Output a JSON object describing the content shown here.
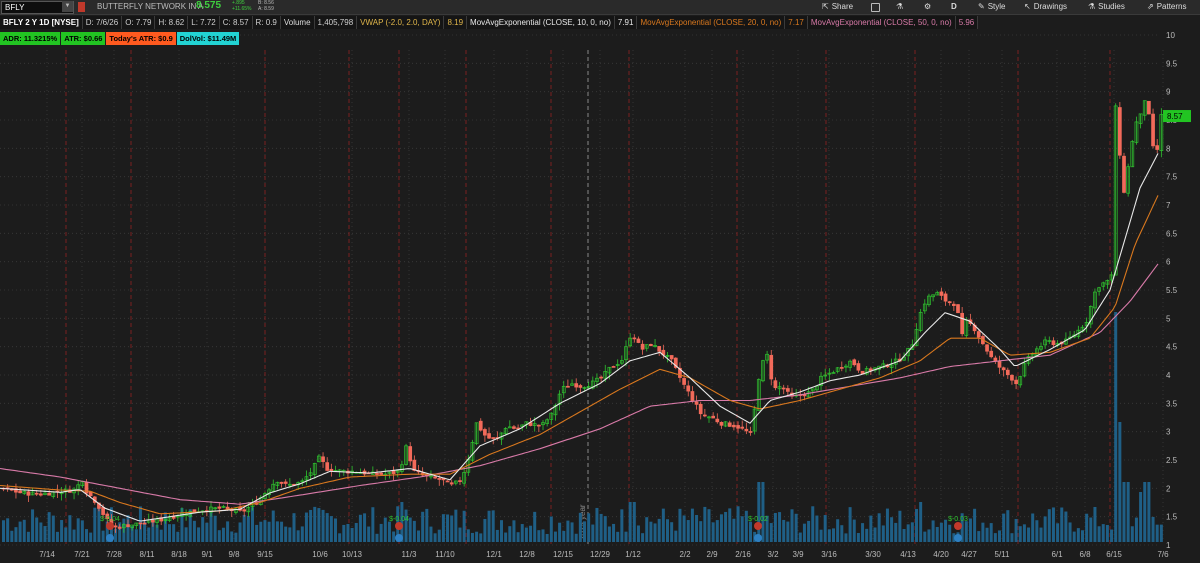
{
  "toolbar": {
    "symbol": "BFLY",
    "company": "BUTTERFLY NETWORK IN A",
    "last": "8.575",
    "change": "+.895",
    "change_pct": "+11.65%",
    "bid": "B: 8.56",
    "ask": "A: 8.59",
    "share": "Share",
    "period": "D",
    "style": "Style",
    "drawings": "Drawings",
    "studies": "Studies",
    "patterns": "Patterns",
    "icons": [
      "share-icon",
      "save-icon",
      "flask-icon",
      "settings-icon",
      "style-icon",
      "drawings-icon",
      "studies-icon",
      "patterns-icon"
    ]
  },
  "infobar": {
    "title": "BFLY 2 Y 1D [NYSE]",
    "date": "D: 7/6/26",
    "open": "O: 7.79",
    "high": "H: 8.62",
    "low": "L: 7.72",
    "close": "C: 8.57",
    "range": "R: 0.9",
    "volume_label": "Volume",
    "volume": "1,405,798",
    "vwap_label": "VWAP (-2.0, 2.0, DAY)",
    "vwap": "8.19",
    "ema10_label": "MovAvgExponential (CLOSE, 10, 0, no)",
    "ema10": "7.91",
    "ema20_label": "MovAvgExponential (CLOSE, 20, 0, no)",
    "ema20": "7.17",
    "ema50_label": "MovAvgExponential (CLOSE, 50, 0, no)",
    "ema50": "5.96"
  },
  "studies": [
    {
      "label": "ADR: 11.3215%",
      "bg": "#22c422"
    },
    {
      "label": "ATR: $0.66",
      "bg": "#22c422"
    },
    {
      "label": "Today's ATR: $0.9",
      "bg": "#ff5a1f"
    },
    {
      "label": "DolVol: $11.49M",
      "bg": "#22d3d3"
    }
  ],
  "colors": {
    "up": "#2fc42f",
    "down": "#f26a5a",
    "ema10": "#e8e8e8",
    "ema20": "#d9781e",
    "ema50": "#d87aa8",
    "volume": "#1f5f86",
    "grid": "#3a3a3a",
    "vline": "#7a2020"
  },
  "chart_data": {
    "type": "candlestick",
    "y_axis": {
      "min": 1,
      "max": 10,
      "ticks": [
        "10",
        "9.5",
        "9",
        "8.5",
        "8",
        "7.5",
        "7",
        "6.5",
        "6",
        "5.5",
        "5",
        "4.5",
        "4",
        "3.5",
        "3",
        "2.5",
        "2",
        "1.5",
        "1"
      ]
    },
    "last_price_tag": "8.57",
    "x_ticks": [
      "7/14",
      "7/21",
      "7/28",
      "8/11",
      "8/18",
      "9/1",
      "9/8",
      "9/15",
      "10/6",
      "10/13",
      "11/3",
      "11/10",
      "12/1",
      "12/8",
      "12/15",
      "12/29",
      "1/12",
      "2/2",
      "2/9",
      "2/16",
      "3/2",
      "3/9",
      "3/16",
      "3/30",
      "4/13",
      "4/20",
      "4/27",
      "5/11",
      "6/1",
      "6/8",
      "6/15",
      "7/6"
    ],
    "year_marker": "2025 year",
    "dividend_labels": [
      "$-0.04",
      "$-0.04",
      "$-0.02",
      "$-0.03"
    ],
    "close_path": [
      [
        0,
        2.0
      ],
      [
        20,
        1.92
      ],
      [
        40,
        1.9
      ],
      [
        60,
        1.95
      ],
      [
        75,
        1.98
      ],
      [
        80,
        2.2
      ],
      [
        85,
        1.95
      ],
      [
        95,
        1.75
      ],
      [
        105,
        1.45
      ],
      [
        112,
        1.3
      ],
      [
        125,
        1.35
      ],
      [
        140,
        1.38
      ],
      [
        160,
        1.45
      ],
      [
        180,
        1.55
      ],
      [
        200,
        1.62
      ],
      [
        220,
        1.65
      ],
      [
        240,
        1.58
      ],
      [
        255,
        1.75
      ],
      [
        265,
        1.95
      ],
      [
        275,
        2.15
      ],
      [
        285,
        2.05
      ],
      [
        300,
        2.1
      ],
      [
        310,
        2.3
      ],
      [
        318,
        2.55
      ],
      [
        325,
        2.35
      ],
      [
        340,
        2.3
      ],
      [
        355,
        2.3
      ],
      [
        370,
        2.25
      ],
      [
        385,
        2.25
      ],
      [
        398,
        2.3
      ],
      [
        405,
        2.75
      ],
      [
        412,
        2.3
      ],
      [
        425,
        2.2
      ],
      [
        440,
        2.15
      ],
      [
        450,
        2.05
      ],
      [
        460,
        2.15
      ],
      [
        468,
        2.6
      ],
      [
        475,
        3.15
      ],
      [
        485,
        2.9
      ],
      [
        495,
        2.85
      ],
      [
        505,
        3.1
      ],
      [
        515,
        3.05
      ],
      [
        525,
        3.15
      ],
      [
        540,
        3.1
      ],
      [
        550,
        3.3
      ],
      [
        560,
        3.75
      ],
      [
        570,
        3.85
      ],
      [
        580,
        3.8
      ],
      [
        590,
        3.85
      ],
      [
        600,
        3.95
      ],
      [
        610,
        4.15
      ],
      [
        620,
        4.25
      ],
      [
        630,
        4.75
      ],
      [
        640,
        4.45
      ],
      [
        650,
        4.55
      ],
      [
        660,
        4.4
      ],
      [
        670,
        4.25
      ],
      [
        680,
        3.9
      ],
      [
        690,
        3.6
      ],
      [
        700,
        3.3
      ],
      [
        710,
        3.25
      ],
      [
        720,
        3.15
      ],
      [
        735,
        3.1
      ],
      [
        750,
        2.95
      ],
      [
        758,
        4.05
      ],
      [
        765,
        4.4
      ],
      [
        772,
        3.75
      ],
      [
        780,
        3.8
      ],
      [
        790,
        3.6
      ],
      [
        800,
        3.65
      ],
      [
        810,
        3.7
      ],
      [
        820,
        3.95
      ],
      [
        830,
        4.05
      ],
      [
        840,
        4.15
      ],
      [
        850,
        4.25
      ],
      [
        860,
        4.05
      ],
      [
        870,
        4.1
      ],
      [
        880,
        4.15
      ],
      [
        890,
        4.2
      ],
      [
        900,
        4.3
      ],
      [
        910,
        4.5
      ],
      [
        918,
        5.05
      ],
      [
        925,
        5.35
      ],
      [
        935,
        5.45
      ],
      [
        945,
        5.3
      ],
      [
        955,
        5.25
      ],
      [
        960,
        4.65
      ],
      [
        965,
        4.95
      ],
      [
        972,
        4.85
      ],
      [
        980,
        4.6
      ],
      [
        990,
        4.3
      ],
      [
        1000,
        4.1
      ],
      [
        1010,
        3.95
      ],
      [
        1015,
        3.85
      ],
      [
        1025,
        4.25
      ],
      [
        1035,
        4.45
      ],
      [
        1045,
        4.6
      ],
      [
        1055,
        4.55
      ],
      [
        1065,
        4.6
      ],
      [
        1075,
        4.75
      ],
      [
        1085,
        4.95
      ],
      [
        1095,
        5.55
      ],
      [
        1105,
        5.65
      ],
      [
        1110,
        5.7
      ],
      [
        1114,
        8.8
      ],
      [
        1118,
        7.9
      ],
      [
        1122,
        7.2
      ],
      [
        1128,
        7.8
      ],
      [
        1133,
        8.4
      ],
      [
        1140,
        8.6
      ],
      [
        1145,
        9.0
      ],
      [
        1150,
        8.1
      ],
      [
        1155,
        7.8
      ],
      [
        1158,
        8.57
      ]
    ],
    "ema10_path": [
      [
        0,
        2.0
      ],
      [
        60,
        1.93
      ],
      [
        80,
        1.98
      ],
      [
        105,
        1.65
      ],
      [
        140,
        1.42
      ],
      [
        200,
        1.58
      ],
      [
        240,
        1.63
      ],
      [
        270,
        1.92
      ],
      [
        300,
        2.08
      ],
      [
        330,
        2.3
      ],
      [
        370,
        2.27
      ],
      [
        410,
        2.35
      ],
      [
        450,
        2.15
      ],
      [
        480,
        2.75
      ],
      [
        520,
        3.05
      ],
      [
        560,
        3.5
      ],
      [
        600,
        3.85
      ],
      [
        630,
        4.25
      ],
      [
        660,
        4.4
      ],
      [
        690,
        3.95
      ],
      [
        720,
        3.45
      ],
      [
        750,
        3.15
      ],
      [
        770,
        3.55
      ],
      [
        800,
        3.7
      ],
      [
        830,
        3.9
      ],
      [
        860,
        4.0
      ],
      [
        900,
        4.25
      ],
      [
        925,
        4.75
      ],
      [
        945,
        5.1
      ],
      [
        970,
        4.95
      ],
      [
        1000,
        4.45
      ],
      [
        1015,
        4.15
      ],
      [
        1050,
        4.45
      ],
      [
        1085,
        4.8
      ],
      [
        1110,
        5.5
      ],
      [
        1125,
        6.4
      ],
      [
        1140,
        7.3
      ],
      [
        1158,
        7.91
      ]
    ],
    "ema20_path": [
      [
        0,
        2.05
      ],
      [
        60,
        1.97
      ],
      [
        90,
        1.95
      ],
      [
        120,
        1.75
      ],
      [
        160,
        1.55
      ],
      [
        220,
        1.6
      ],
      [
        260,
        1.75
      ],
      [
        300,
        2.0
      ],
      [
        350,
        2.2
      ],
      [
        410,
        2.25
      ],
      [
        450,
        2.25
      ],
      [
        490,
        2.6
      ],
      [
        540,
        2.95
      ],
      [
        580,
        3.35
      ],
      [
        620,
        3.75
      ],
      [
        660,
        4.1
      ],
      [
        690,
        3.95
      ],
      [
        730,
        3.55
      ],
      [
        760,
        3.4
      ],
      [
        800,
        3.55
      ],
      [
        840,
        3.75
      ],
      [
        880,
        3.95
      ],
      [
        920,
        4.25
      ],
      [
        950,
        4.65
      ],
      [
        980,
        4.65
      ],
      [
        1010,
        4.35
      ],
      [
        1050,
        4.4
      ],
      [
        1090,
        4.65
      ],
      [
        1115,
        5.2
      ],
      [
        1135,
        6.3
      ],
      [
        1158,
        7.17
      ]
    ],
    "ema50_path": [
      [
        0,
        2.35
      ],
      [
        60,
        2.2
      ],
      [
        120,
        2.0
      ],
      [
        180,
        1.8
      ],
      [
        240,
        1.72
      ],
      [
        300,
        1.88
      ],
      [
        360,
        2.05
      ],
      [
        420,
        2.2
      ],
      [
        480,
        2.4
      ],
      [
        540,
        2.7
      ],
      [
        600,
        3.05
      ],
      [
        650,
        3.45
      ],
      [
        700,
        3.55
      ],
      [
        750,
        3.55
      ],
      [
        800,
        3.65
      ],
      [
        850,
        3.8
      ],
      [
        900,
        3.95
      ],
      [
        950,
        4.15
      ],
      [
        1000,
        4.25
      ],
      [
        1050,
        4.35
      ],
      [
        1100,
        4.75
      ],
      [
        1130,
        5.3
      ],
      [
        1158,
        5.96
      ]
    ]
  }
}
